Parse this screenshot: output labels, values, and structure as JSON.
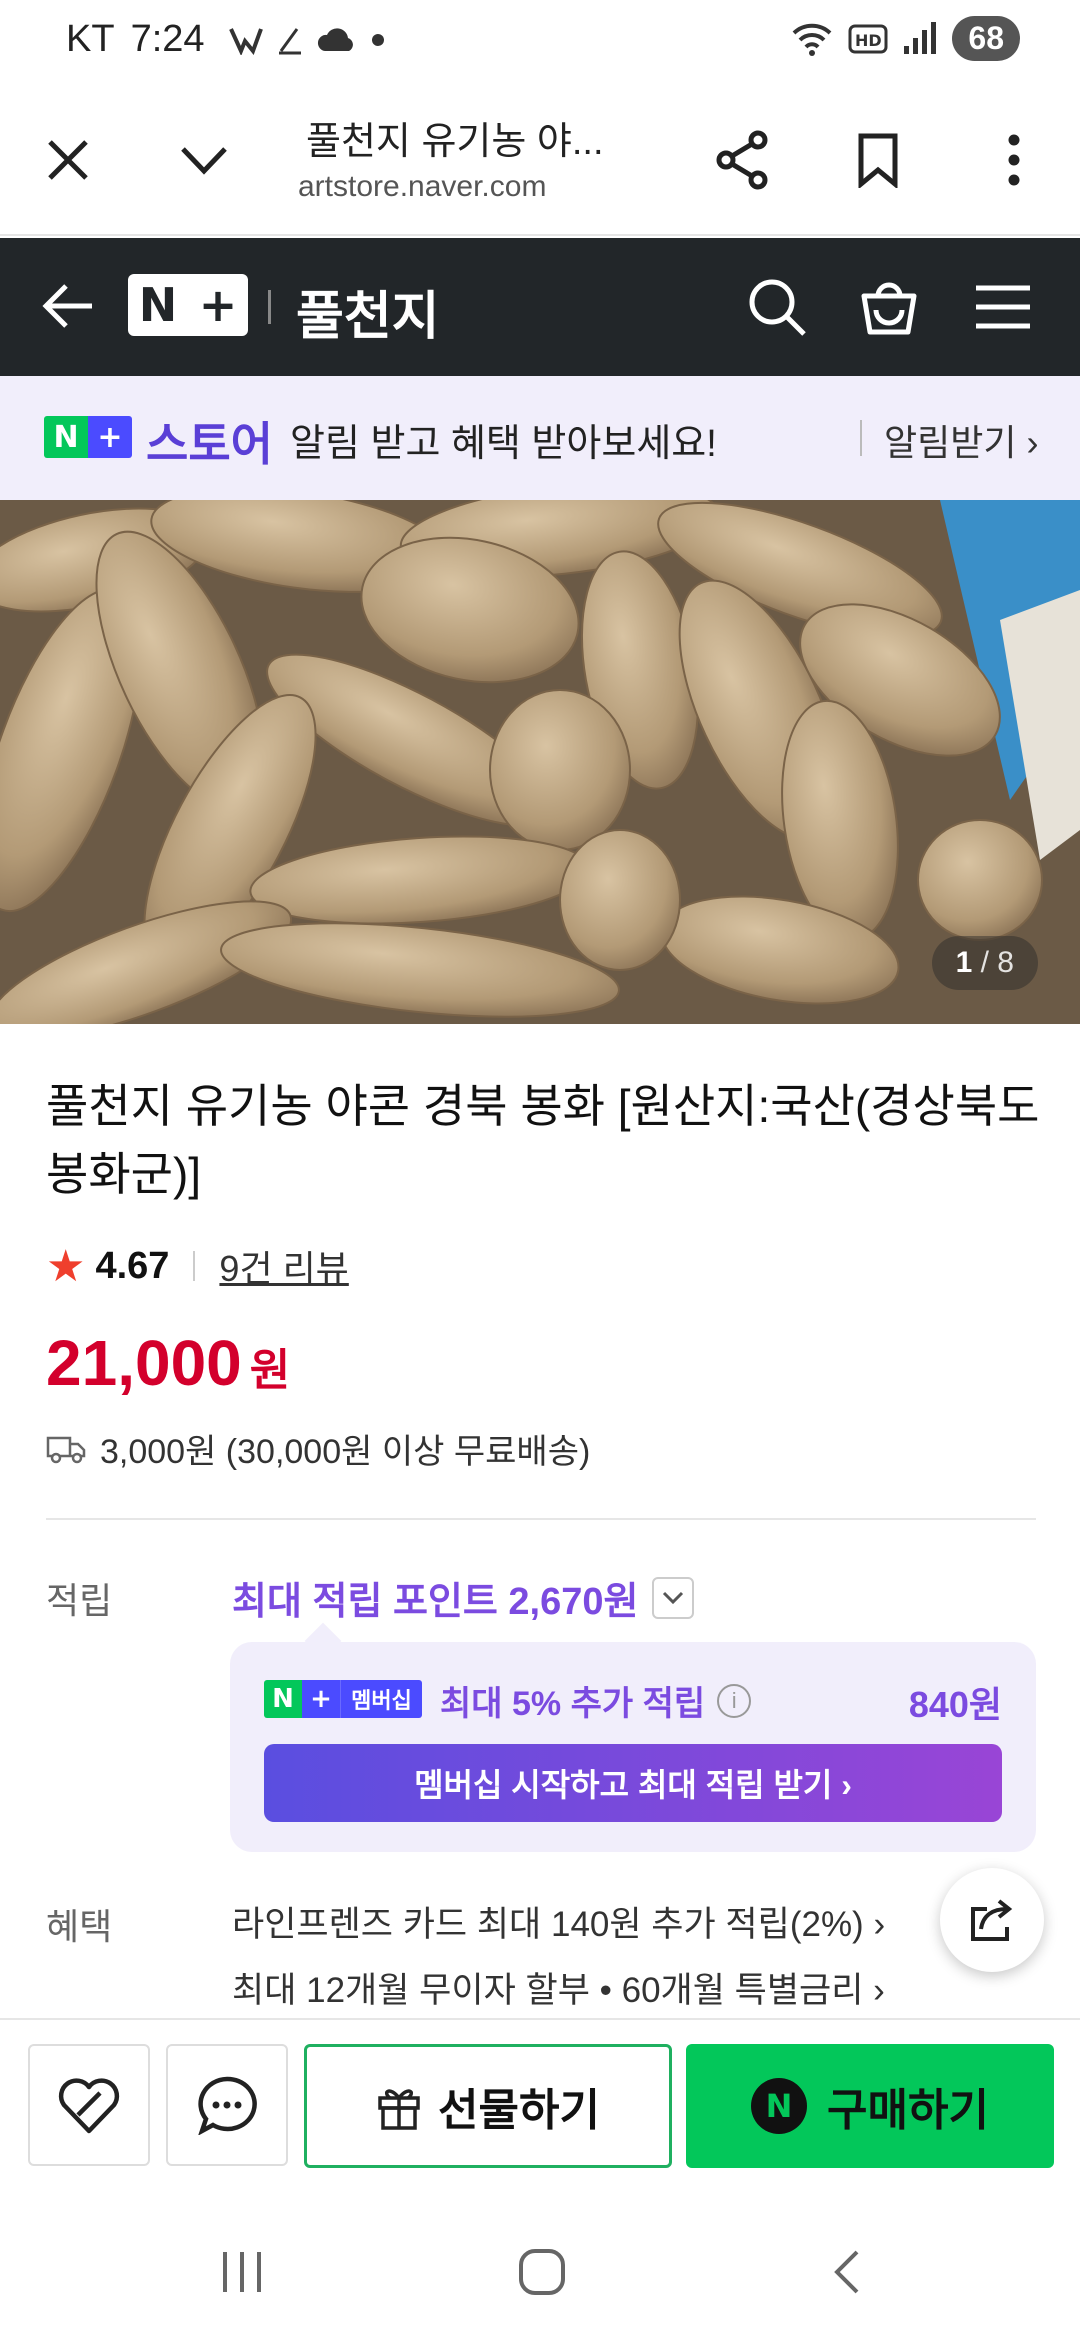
{
  "status_bar": {
    "carrier": "KT",
    "time": "7:24",
    "battery": "68"
  },
  "browser": {
    "title": "풀천지 유기농 야...",
    "url": "artstore.naver.com"
  },
  "store_header": {
    "store_name": "풀천지"
  },
  "notice": {
    "store_word": "스토어",
    "message": "알림 받고 혜택 받아보세요!",
    "cta": "알림받기 ›"
  },
  "image": {
    "current": "1",
    "total": "/ 8"
  },
  "product": {
    "title": "풀천지 유기농 야콘 경북 봉화 [원산지:국산(경상북도 봉화군)]",
    "rating": "4.67",
    "reviews": "9건 리뷰",
    "price": "21,000",
    "price_unit": "원",
    "shipping": "3,000원 (30,000원 이상 무료배송)"
  },
  "points": {
    "label": "적립",
    "max_points": "최대 적립 포인트 2,670원",
    "membership_badge": "멤버십",
    "membership_text": "최대 5% 추가 적립",
    "membership_amount": "840원",
    "membership_button": "멤버십 시작하고 최대 적립 받기 ›"
  },
  "benefits": {
    "label": "혜택",
    "lines": [
      "라인프렌즈 카드 최대 140원 추가 적립(2%) ›",
      "최대 12개월 무이자 할부 • 60개월 특별금리 ›"
    ]
  },
  "actions": {
    "gift": "선물하기",
    "buy": "구매하기"
  },
  "colors": {
    "brand_green": "#03c75a",
    "price_red": "#d3002c",
    "purple": "#7b4be0",
    "header_dark": "#222629"
  },
  "icons": [
    "close-icon",
    "chevron-down-icon",
    "share-icon",
    "bookmark-icon",
    "more-icon",
    "back-arrow-icon",
    "search-icon",
    "cart-icon",
    "menu-icon",
    "star-icon",
    "truck-icon",
    "info-icon",
    "heart-icon",
    "chat-icon",
    "gift-icon"
  ]
}
